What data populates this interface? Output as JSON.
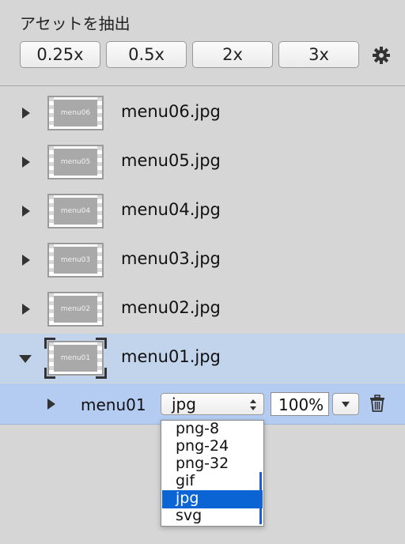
{
  "header": {
    "title": "アセットを抽出",
    "scale_buttons": [
      "0.25x",
      "0.5x",
      "2x",
      "3x"
    ]
  },
  "assets": [
    {
      "thumb_label": "menu06",
      "filename": "menu06.jpg",
      "expanded": false
    },
    {
      "thumb_label": "menu05",
      "filename": "menu05.jpg",
      "expanded": false
    },
    {
      "thumb_label": "menu04",
      "filename": "menu04.jpg",
      "expanded": false
    },
    {
      "thumb_label": "menu03",
      "filename": "menu03.jpg",
      "expanded": false
    },
    {
      "thumb_label": "menu02",
      "filename": "menu02.jpg",
      "expanded": false
    },
    {
      "thumb_label": "menu01",
      "filename": "menu01.jpg",
      "expanded": true
    }
  ],
  "layer": {
    "name": "menu01",
    "format": "jpg",
    "scale": "100%"
  },
  "format_options": [
    "png-8",
    "png-24",
    "png-32",
    "gif",
    "jpg",
    "svg"
  ],
  "selected_format": "jpg",
  "colors": {
    "panel_bg": "#d6d6d6",
    "selected_asset_bg": "#c2d3ec",
    "layer_row_bg": "#b4ccf2",
    "menu_highlight": "#0a64d4"
  }
}
